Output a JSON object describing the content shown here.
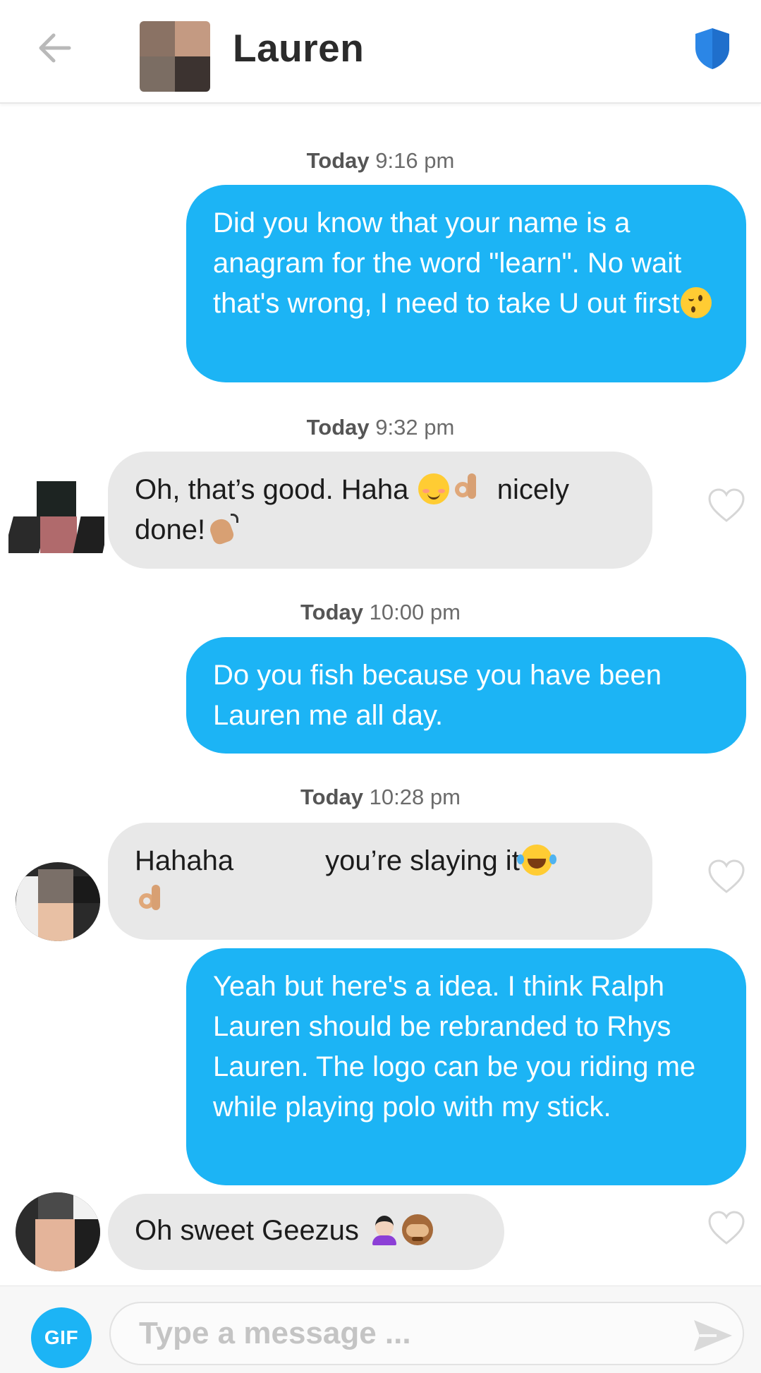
{
  "header": {
    "back_icon": "arrow-left-icon",
    "contact_name": "Lauren",
    "safety_icon": "shield-icon",
    "accent_color": "#1cb4f5"
  },
  "timestamps": [
    {
      "day": "Today",
      "time": "9:16 pm"
    },
    {
      "day": "Today",
      "time": "9:32 pm"
    },
    {
      "day": "Today",
      "time": "10:00 pm"
    },
    {
      "day": "Today",
      "time": "10:28 pm"
    }
  ],
  "messages": [
    {
      "side": "sent",
      "text": "Did you know that your name is a anagram for the word \"learn\". No wait that's wrong, I need to take U out first",
      "emoji": [
        "winking-face"
      ]
    },
    {
      "side": "received",
      "text_a": "Oh, that’s good. Haha",
      "text_b": "nicely",
      "text_c": "done!",
      "emoji": [
        "smiling-face-blush",
        "ok-hand",
        "clapping-hands"
      ]
    },
    {
      "side": "sent",
      "text": "Do you fish because you have been Lauren me all day."
    },
    {
      "side": "received",
      "text_a": "Hahaha",
      "text_b": "you’re slaying it",
      "emoji": [
        "tears-of-joy",
        "ok-hand"
      ]
    },
    {
      "side": "sent",
      "text": "Yeah but here's a idea. I think Ralph Lauren should be rebranded to Rhys Lauren. The logo can be you riding me while playing polo with my stick."
    },
    {
      "side": "received",
      "text": "Oh sweet Geezus",
      "emoji": [
        "woman-facepalming",
        "see-no-evil-monkey"
      ]
    }
  ],
  "like_icon": "heart-outline-icon",
  "input_bar": {
    "gif_label": "GIF",
    "placeholder": "Type a message ...",
    "value": "",
    "send_icon": "send-icon"
  }
}
